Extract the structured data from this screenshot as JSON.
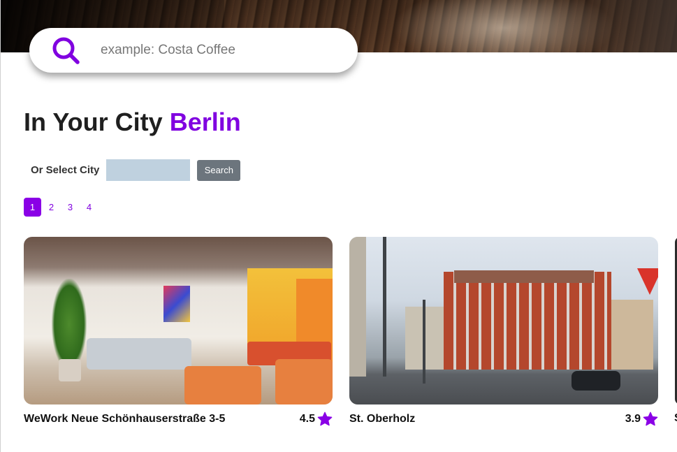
{
  "search": {
    "placeholder": "example: Costa Coffee",
    "icon": "search-icon"
  },
  "heading": {
    "prefix": "In Your City",
    "city": "Berlin"
  },
  "city_select": {
    "label": "Or Select City",
    "value": "",
    "button_label": "Search"
  },
  "pagination": {
    "pages": [
      "1",
      "2",
      "3",
      "4"
    ],
    "active": "1"
  },
  "colors": {
    "accent": "#8000e0",
    "button_gray": "#6c757d",
    "input_bg": "#bfd1df"
  },
  "cards": [
    {
      "name": "WeWork Neue Schönhauserstraße 3-5",
      "rating": "4.5",
      "rating_icon": "star-icon"
    },
    {
      "name": "St. Oberholz",
      "rating": "3.9",
      "rating_icon": "star-icon"
    }
  ],
  "partial_card": {
    "name_visible": "S"
  }
}
